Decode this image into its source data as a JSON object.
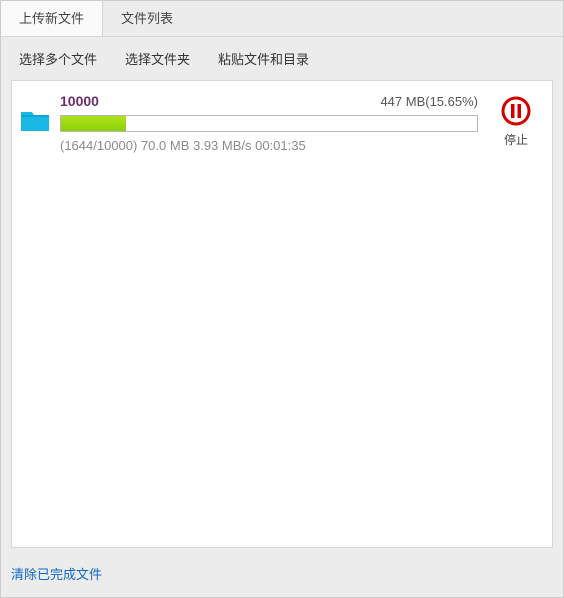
{
  "tabs": {
    "upload_new": "上传新文件",
    "file_list": "文件列表"
  },
  "toolbar": {
    "select_files": "选择多个文件",
    "select_folder": "选择文件夹",
    "paste_files_dirs": "粘贴文件和目录"
  },
  "upload_item": {
    "name": "10000",
    "size_text": "447 MB",
    "percent_text": "(15.65%)",
    "percent_value": 15.65,
    "stats_text": "(1644/10000) 70.0 MB 3.93 MB/s 00:01:35"
  },
  "action": {
    "pause_label": "停止"
  },
  "footer": {
    "clear_completed": "清除已完成文件"
  }
}
